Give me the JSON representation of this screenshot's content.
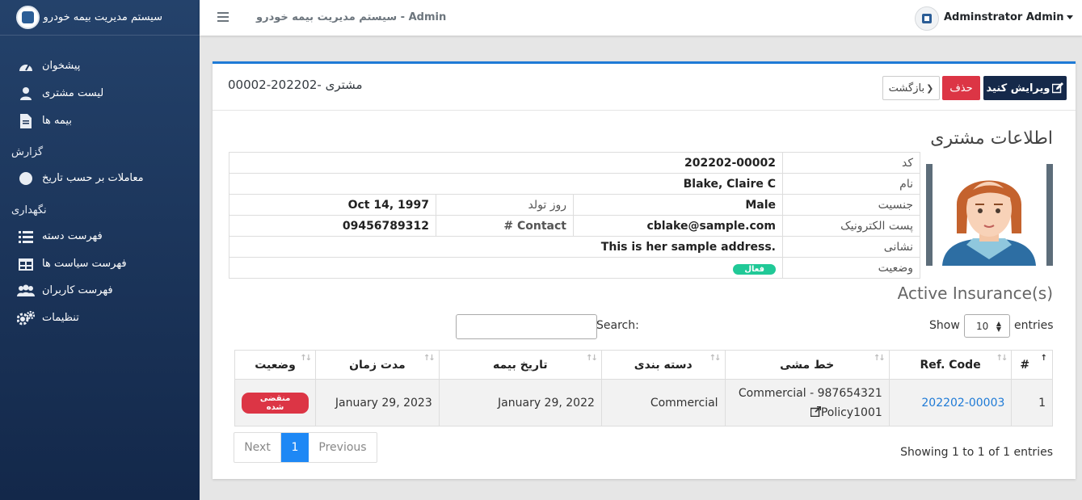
{
  "sidebar": {
    "brand_title": "سیستم مدیریت بیمه خودرو",
    "items": [
      {
        "label": "پیشخوان",
        "icon": "dashboard-icon"
      },
      {
        "label": "لیست مشتری",
        "icon": "user-icon"
      },
      {
        "label": "بیمه ها",
        "icon": "file-icon"
      }
    ],
    "report_section": "گزارش",
    "report_items": [
      {
        "label": "معاملات بر حسب تاریخ",
        "icon": "circle-icon"
      }
    ],
    "maintenance_section": "نگهداری",
    "maintenance_items": [
      {
        "label": "فهرست دسته",
        "icon": "list-icon"
      },
      {
        "label": "فهرست سیاست ها",
        "icon": "table-icon"
      },
      {
        "label": "فهرست کاربران",
        "icon": "users-icon"
      },
      {
        "label": "تنظیمات",
        "icon": "cogs-icon"
      }
    ]
  },
  "topbar": {
    "title": "سیستم مدیریت بیمه خودرو - Admin",
    "user_name": "Adminstrator Admin"
  },
  "card": {
    "title": "مشتری -202202-00002",
    "edit_label": "ویرایش کنید",
    "delete_label": "حذف",
    "back_label": "بازگشت"
  },
  "customer": {
    "section_title": "اطلاعات مشتری",
    "code_label": "کد",
    "code": "202202-00002",
    "name_label": "نام",
    "name": "Blake, Claire C",
    "gender_label": "جنسیت",
    "gender": "Male",
    "dob_label": "روز تولد",
    "dob": "Oct 14, 1997",
    "email_label": "پست الکترونیک",
    "email": "cblake@sample.com",
    "contact_label": "Contact #",
    "contact": "09456789312",
    "address_label": "نشانی",
    "address": "This is her sample address.",
    "status_label": "وضعیت",
    "status": "فعال"
  },
  "insurance": {
    "title": "Active Insurance(s)",
    "search_label": "Search:",
    "show_label": "Show",
    "page_length": "10",
    "entries_label": "entries",
    "columns": [
      "#",
      "Ref. Code",
      "خط مشی",
      "دسته بندی",
      "تاریخ بیمه",
      "مدت زمان",
      "وضعیت"
    ],
    "rows": [
      {
        "index": "1",
        "ref_code": "202202-00003",
        "policy_line1": "Commercial - 987654321",
        "policy_line2": "Policy1001",
        "category": "Commercial",
        "insurance_date": "January 29, 2022",
        "expiry": "January 29, 2023",
        "status": "منقضی شده"
      }
    ],
    "showing": "Showing 1 to 1 of 1 entries",
    "pager": {
      "next": "Next",
      "current": "1",
      "previous": "Previous"
    }
  },
  "colors": {
    "sidebar_top": "#24426b",
    "sidebar_bottom": "#13284a",
    "accent": "#1e7ad6",
    "danger": "#dc3545",
    "success": "#20c997",
    "edit_button": "#15294a"
  }
}
